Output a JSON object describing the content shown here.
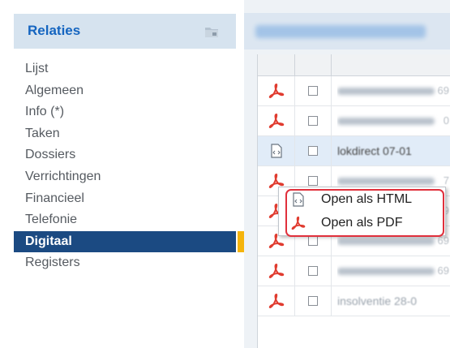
{
  "sidebar": {
    "title": "Relaties",
    "header_icon": "folder-icon",
    "items": [
      {
        "label": "Lijst",
        "active": false
      },
      {
        "label": "Algemeen",
        "active": false
      },
      {
        "label": "Info (*)",
        "active": false
      },
      {
        "label": "Taken",
        "active": false
      },
      {
        "label": "Dossiers",
        "active": false
      },
      {
        "label": "Verrichtingen",
        "active": false
      },
      {
        "label": "Financieel",
        "active": false
      },
      {
        "label": "Telefonie",
        "active": false
      },
      {
        "label": "Digitaal",
        "active": true
      },
      {
        "label": "Registers",
        "active": false
      }
    ],
    "active_color": "#1b4a82",
    "accent_color": "#f5b40c"
  },
  "table": {
    "rows": [
      {
        "icon": "pdf-icon",
        "trailing": "69"
      },
      {
        "icon": "pdf-icon",
        "trailing": "0"
      },
      {
        "icon": "html-file-icon",
        "text": "lokdirect 07-01",
        "selected": true
      },
      {
        "icon": "pdf-icon",
        "trailing": "7"
      },
      {
        "icon": "pdf-icon",
        "trailing": "9"
      },
      {
        "icon": "pdf-icon",
        "trailing": "69"
      },
      {
        "icon": "pdf-icon",
        "trailing": "69"
      },
      {
        "icon": "pdf-icon",
        "text": "insolventie 28-0"
      }
    ]
  },
  "context_menu": {
    "items": [
      {
        "label": "Open als HTML",
        "icon": "html-file-icon"
      },
      {
        "label": "Open als PDF",
        "icon": "pdf-icon"
      }
    ],
    "highlight_color": "#e0303c"
  }
}
